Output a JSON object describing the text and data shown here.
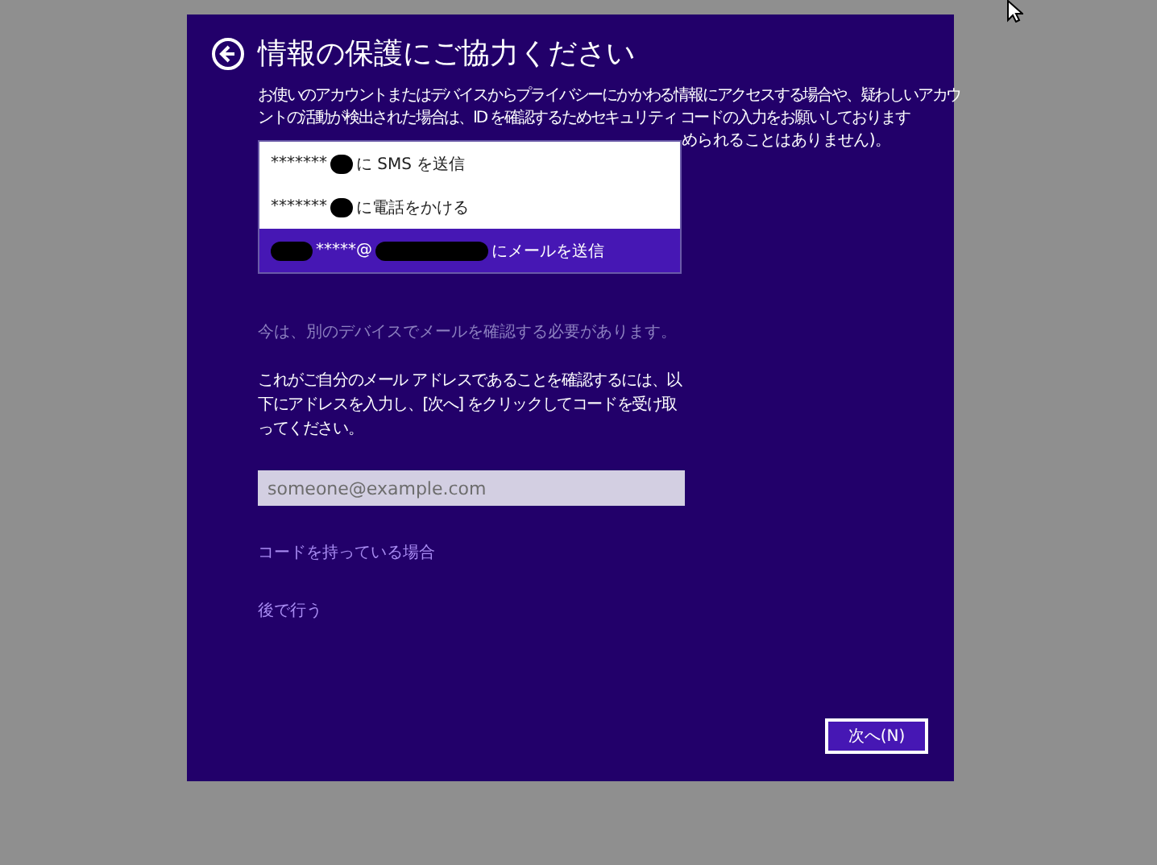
{
  "dialog": {
    "title": "情報の保護にご協力ください",
    "description_lines": [
      "お使いのアカウントまたはデバイスからプライバシーにかかわる情報にアクセスする場合や、疑わしいアカウ",
      "ントの活動が検出された場合は、ID を確認するためセキュリティ コードの入力をお願いしております"
    ],
    "description_tail": "められることはありません)。",
    "options": [
      {
        "masked": "*******",
        "text": "に SMS を送信",
        "leading_redaction": false,
        "selected": false
      },
      {
        "masked": "*******",
        "text": "に電話をかける",
        "leading_redaction": false,
        "selected": false
      },
      {
        "masked": "*****@",
        "text": "にメールを送信",
        "leading_redaction": true,
        "selected": true
      }
    ],
    "hint": "今は、別のデバイスでメールを確認する必要があります。",
    "instruction": "これがご自分のメール アドレスであることを確認するには、以下にアドレスを入力し、[次へ] をクリックしてコードを受け取ってください。",
    "email_field": {
      "placeholder": "someone@example.com"
    },
    "links": [
      "コードを持っている場合",
      "後で行う"
    ],
    "next_button": "次へ(N)"
  }
}
